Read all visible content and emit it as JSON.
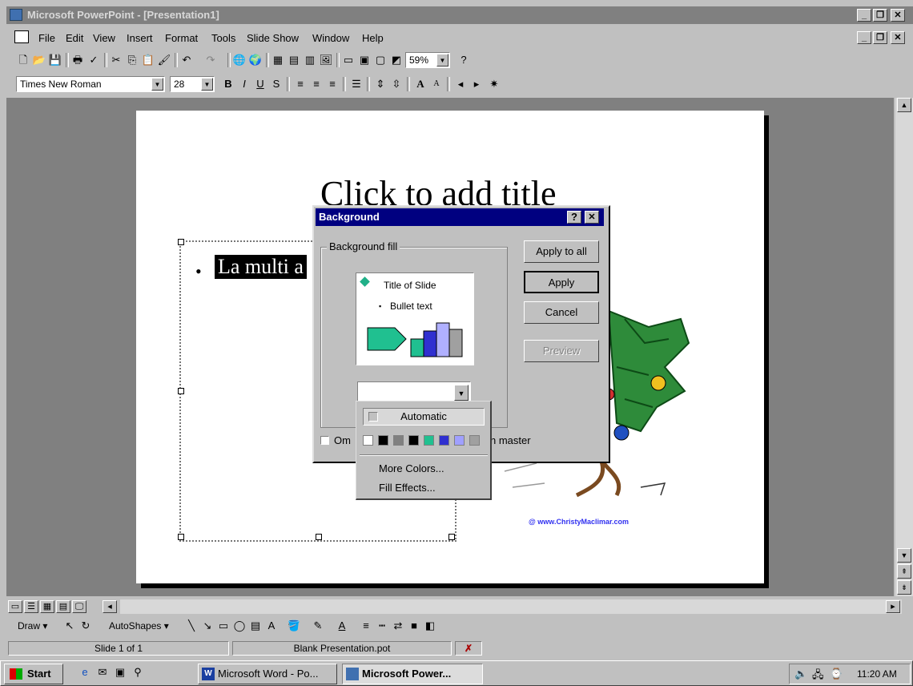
{
  "app": {
    "title": "Microsoft PowerPoint - [Presentation1]",
    "window_buttons": [
      "_",
      "❐",
      "✕"
    ]
  },
  "menu": {
    "items": [
      "File",
      "Edit",
      "View",
      "Insert",
      "Format",
      "Tools",
      "Slide Show",
      "Window",
      "Help"
    ]
  },
  "toolbar": {
    "zoom": "59%",
    "font_name": "Times New Roman",
    "font_size": "28",
    "bold": "B",
    "italic": "I",
    "underline": "U",
    "shadow": "S"
  },
  "slide": {
    "title": "Click to add title",
    "bullet": "•",
    "bullet_text": "La multi a",
    "watermark": "@ www.ChristyMaclimar.com"
  },
  "dialog": {
    "title": "Background",
    "help": "?",
    "close": "✕",
    "group_label": "Background fill",
    "preview_title": "Title of Slide",
    "preview_bullet": "Bullet text",
    "buttons": {
      "apply_all": "Apply to all",
      "apply": "Apply",
      "cancel": "Cancel",
      "preview": "Preview"
    },
    "omit_label_left": "Om",
    "omit_label_right": "n master"
  },
  "popup": {
    "automatic": "Automatic",
    "swatches": [
      "#ffffff",
      "#000000",
      "#808080",
      "#000000",
      "#20c090",
      "#3030d0",
      "#a0a0ff",
      "#a0a0a0"
    ],
    "more_colors": "More Colors...",
    "fill_effects": "Fill Effects..."
  },
  "drawbar": {
    "draw": "Draw",
    "autoshapes": "AutoShapes"
  },
  "status": {
    "slide": "Slide 1 of 1",
    "template": "Blank Presentation.pot"
  },
  "taskbar": {
    "start": "Start",
    "tasks": [
      "Microsoft Word - Po...",
      "Microsoft Power..."
    ],
    "clock": "11:20 AM"
  },
  "colors": {
    "dialog_title_bg": "#000080",
    "desktop_gray": "#c0c0c0",
    "workspace_gray": "#808080"
  }
}
